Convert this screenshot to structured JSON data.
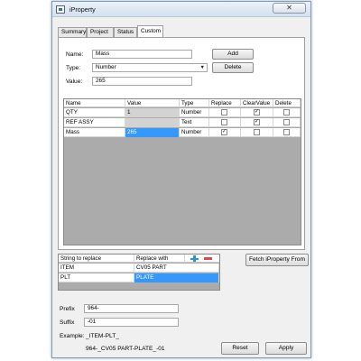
{
  "window": {
    "title": "iProperty",
    "close_glyph": "✕"
  },
  "tabs": [
    {
      "label": "Summary"
    },
    {
      "label": "Project"
    },
    {
      "label": "Status"
    },
    {
      "label": "Custom"
    }
  ],
  "form": {
    "name_label": "Name:",
    "name_value": "Mass",
    "type_label": "Type:",
    "type_value": "Number",
    "value_label": "Value:",
    "value_value": "265",
    "add_label": "Add",
    "delete_label": "Delete"
  },
  "properties_table": {
    "columns": [
      "Name",
      "Value",
      "Type",
      "Replace",
      "ClearValue",
      "Delete"
    ],
    "rows": [
      {
        "name": "QTY",
        "value": "1",
        "type": "Number",
        "replace": false,
        "clear_value": true,
        "delete": false
      },
      {
        "name": "REF ASSY",
        "value": "",
        "type": "Text",
        "replace": false,
        "clear_value": true,
        "delete": false
      },
      {
        "name": "Mass",
        "value": "265",
        "type": "Number",
        "replace": true,
        "clear_value": false,
        "delete": false
      }
    ]
  },
  "replace_table": {
    "columns": [
      "String to replace",
      "Replace with"
    ],
    "add_icon": "plus-icon",
    "remove_icon": "minus-icon",
    "rows": [
      {
        "find": "ITEM",
        "replace": "CV05 PART"
      },
      {
        "find": "PLT",
        "replace": "PLATE"
      }
    ]
  },
  "fetch_label": "Fetch iProperty From",
  "prefix_label": "Prefix",
  "prefix_value": "964-",
  "suffix_label": "Suffix",
  "suffix_value": "-01",
  "example_label": "Example:",
  "example_pattern": "_ITEM-PLT_",
  "example_result": "964-_CV05 PART-PLATE_-01",
  "reset_label": "Reset",
  "apply_label": "Apply",
  "colors": {
    "selection": "#3399ff",
    "grid_background": "#ababab",
    "plus": "#2b8fd9",
    "minus": "#e0474c"
  }
}
